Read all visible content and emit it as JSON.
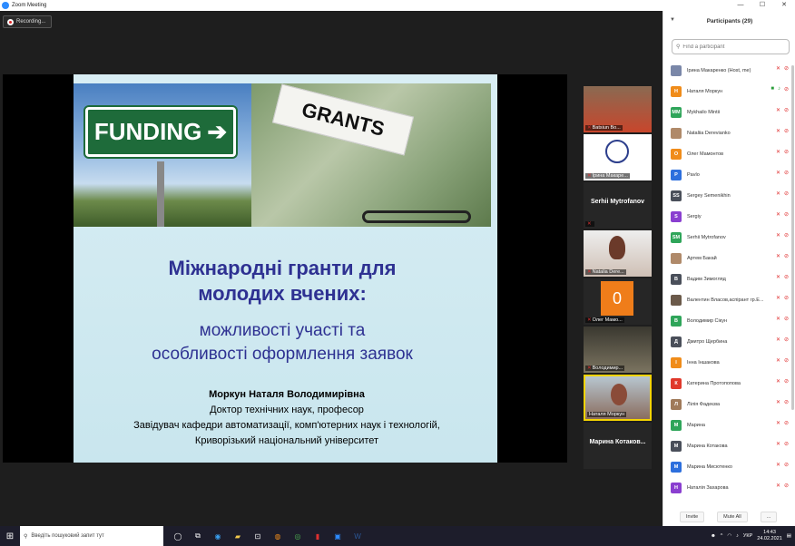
{
  "window": {
    "title": "Zoom Meeting",
    "minimize": "—",
    "maximize": "☐",
    "close": "✕"
  },
  "recording": {
    "label": "Recording..."
  },
  "slide": {
    "funding_text": "FUNDING",
    "grants_text": "GRANTS",
    "title_line1": "Міжнародні гранти для",
    "title_line2": "молодих вчених:",
    "subtitle_line1": "можливості участі та",
    "subtitle_line2": "особливості оформлення заявок",
    "author_name": "Моркун Наталя Володимирівна",
    "author_degree": "Доктор технічних наук, професор",
    "author_position": "Завідувач кафедри автоматизації, комп'ютерних наук і технологій,",
    "author_university": "Криворізький національний університет"
  },
  "gallery": [
    {
      "label": "Batsiun Bo..."
    },
    {
      "label": "Ірина Макаре..."
    },
    {
      "name": "Serhii Mytrofanov",
      "label": ""
    },
    {
      "label": "Natalia Dere..."
    },
    {
      "letter": "0",
      "label": "Олег Мамо..."
    },
    {
      "label": "Володимир..."
    },
    {
      "label": "Наталя Моркун"
    },
    {
      "name": "Марина Котаков...",
      "label": ""
    }
  ],
  "participants": {
    "title": "Participants (29)",
    "search_placeholder": "Find a participant",
    "invite_label": "Invite",
    "mute_all_label": "Mute All",
    "more_label": "...",
    "items": [
      {
        "initials": "",
        "name": "Ірина Макаренко (Host, me)",
        "color": "#7a87a8"
      },
      {
        "initials": "Н",
        "name": "Наталя Моркун",
        "color": "#f08c1a"
      },
      {
        "initials": "MM",
        "name": "Mykhailo Mintii",
        "color": "#2fa55a"
      },
      {
        "initials": "",
        "name": "Nataliia Derevianko",
        "color": "#b08a6a"
      },
      {
        "initials": "О",
        "name": "Олег Мамонтов",
        "color": "#f08c1a"
      },
      {
        "initials": "P",
        "name": "Pavlo",
        "color": "#2d6fdd"
      },
      {
        "initials": "SS",
        "name": "Sergey Semenikhin",
        "color": "#4a4f5a"
      },
      {
        "initials": "S",
        "name": "Sergiy",
        "color": "#8a3fd0"
      },
      {
        "initials": "SM",
        "name": "Serhii Mytrofanov",
        "color": "#2fa55a"
      },
      {
        "initials": "",
        "name": "Артем Бакай",
        "color": "#b08a6a"
      },
      {
        "initials": "В",
        "name": "Вадим Зимогляд",
        "color": "#4a4f5a"
      },
      {
        "initials": "",
        "name": "Валентин Власов,аспірант гр.Е...",
        "color": "#6b5a4a"
      },
      {
        "initials": "В",
        "name": "Володимир Сікун",
        "color": "#2fa55a"
      },
      {
        "initials": "Д",
        "name": "Дмитро Щербина",
        "color": "#4a4f5a"
      },
      {
        "initials": "І",
        "name": "Інна Іншакова",
        "color": "#f08c1a"
      },
      {
        "initials": "К",
        "name": "Катерина Протопопова",
        "color": "#e0392b"
      },
      {
        "initials": "Л",
        "name": "Лілія Фадеєва",
        "color": "#a07a5a"
      },
      {
        "initials": "М",
        "name": "Марина",
        "color": "#2fa55a"
      },
      {
        "initials": "М",
        "name": "Марина Котакова",
        "color": "#4a4f5a"
      },
      {
        "initials": "М",
        "name": "Марина Мисютенко",
        "color": "#2d6fdd"
      },
      {
        "initials": "Н",
        "name": "Наталія Захарова",
        "color": "#8a3fd0"
      }
    ]
  },
  "taskbar": {
    "search_placeholder": "Введіть пошуковий запит тут",
    "lang": "УКР",
    "time": "14:43",
    "date": "24.02.2021"
  }
}
